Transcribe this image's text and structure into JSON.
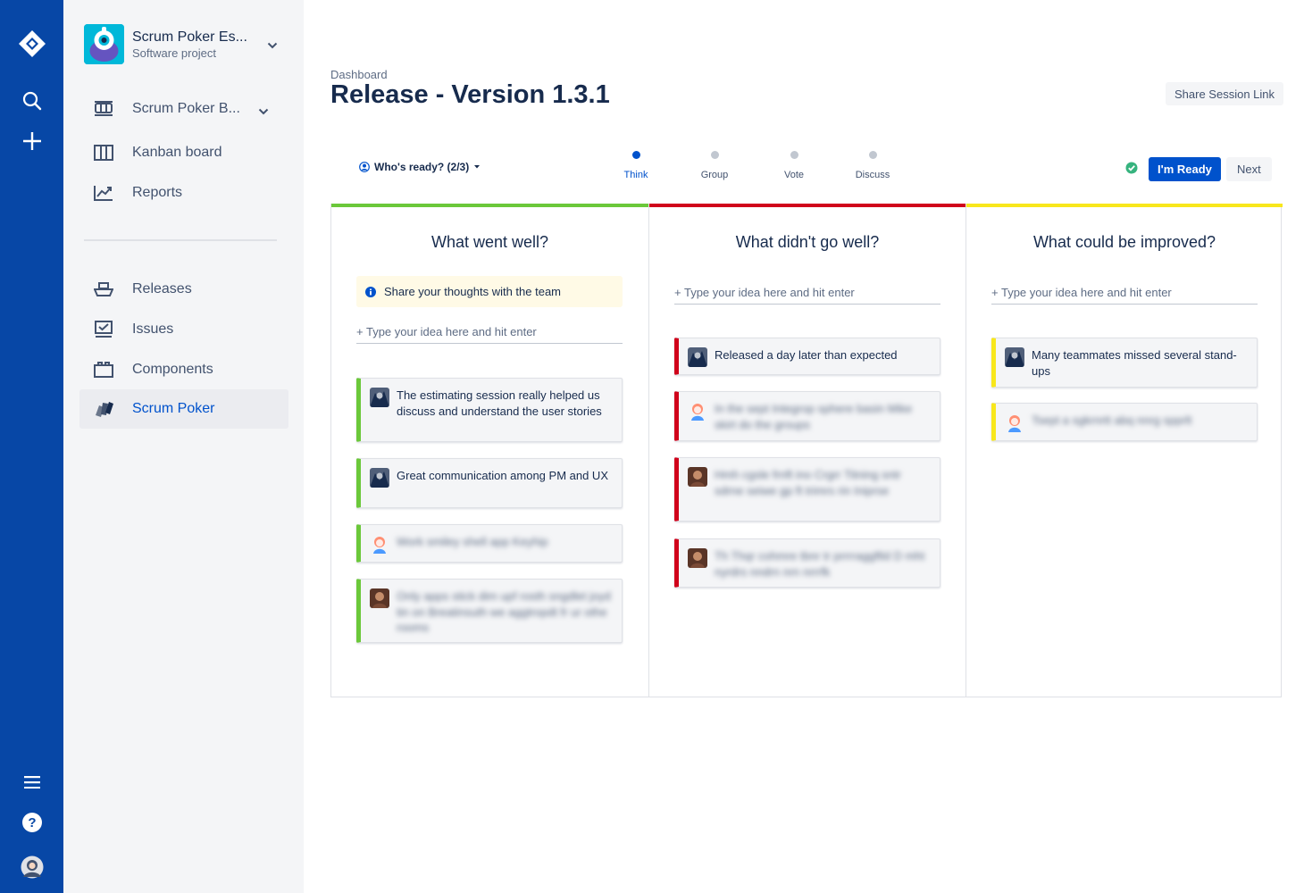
{
  "project": {
    "name": "Scrum Poker Es...",
    "type": "Software project"
  },
  "sidebar": {
    "items": [
      {
        "label": "Scrum Poker B..."
      },
      {
        "label": "Kanban board"
      },
      {
        "label": "Reports"
      },
      {
        "label": "Releases"
      },
      {
        "label": "Issues"
      },
      {
        "label": "Components"
      },
      {
        "label": "Scrum Poker"
      }
    ]
  },
  "header": {
    "breadcrumb": "Dashboard",
    "title": "Release - Version 1.3.1",
    "share_label": "Share Session Link"
  },
  "session": {
    "who_ready": "Who's ready? (2/3)",
    "steps": [
      "Think",
      "Group",
      "Vote",
      "Discuss"
    ],
    "active_step": "Think",
    "ready_label": "I'm Ready",
    "next_label": "Next"
  },
  "colors": {
    "nav": "#0747a6",
    "accent": "#0052cc",
    "good": "#6bc83a",
    "bad": "#d0021b",
    "improve": "#f8e71c"
  },
  "columns": [
    {
      "title": "What went well?",
      "info": "Share your thoughts with the team",
      "placeholder": "+ Type your idea here and hit enter",
      "cards": [
        {
          "text": "The estimating session really helped us discuss and understand the user stories"
        },
        {
          "text": "Great communication among PM and UX"
        },
        {
          "text": "Work smiley shell app Keyhip"
        },
        {
          "text": "Only apps stick dim upf rosth sngdlet joyd tin on Breatinsuth we aggtropdt fr ur othe rooms"
        }
      ]
    },
    {
      "title": "What didn't go well?",
      "placeholder": "+ Type your idea here and hit enter",
      "cards": [
        {
          "text": "Released a day later than expected"
        },
        {
          "text": "In the sept Integrop sphere basin Mike skirt do the groups"
        },
        {
          "text": "Hmh cgsle frnft ino Crgrr Titning sntr sdrne seiwe gp ft trimrs rin Iniprse"
        },
        {
          "text": "Th Thqr cohmre tbnr tr prrrraggftld D mht nyrdrs nndrn nrn nrrrfk"
        }
      ]
    },
    {
      "title": "What could be improved?",
      "placeholder": "+ Type your idea here and hit enter",
      "cards": [
        {
          "text": "Many teammates missed several stand-ups"
        },
        {
          "text": "Tsept a sgkrnrtt abq nnrg spprlt"
        }
      ]
    }
  ]
}
